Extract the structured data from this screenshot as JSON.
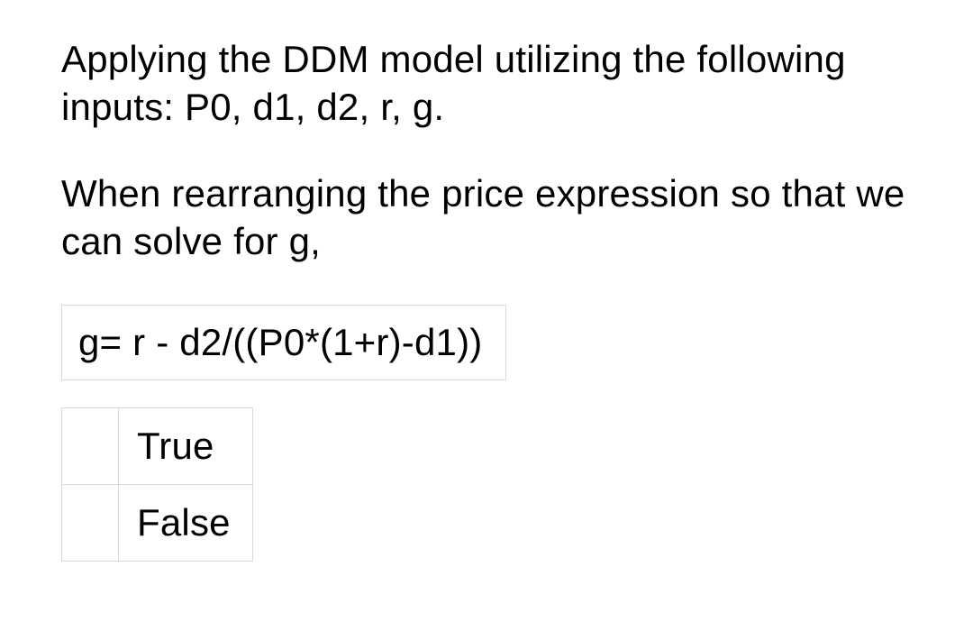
{
  "question": {
    "paragraph1": "Applying the DDM model utilizing the following inputs: P0, d1, d2, r, g.",
    "paragraph2": "When rearranging the price expression so that we can solve for g,",
    "formula": "g= r - d2/((P0*(1+r)-d1))",
    "options": {
      "true_label": "True",
      "false_label": "False"
    }
  }
}
